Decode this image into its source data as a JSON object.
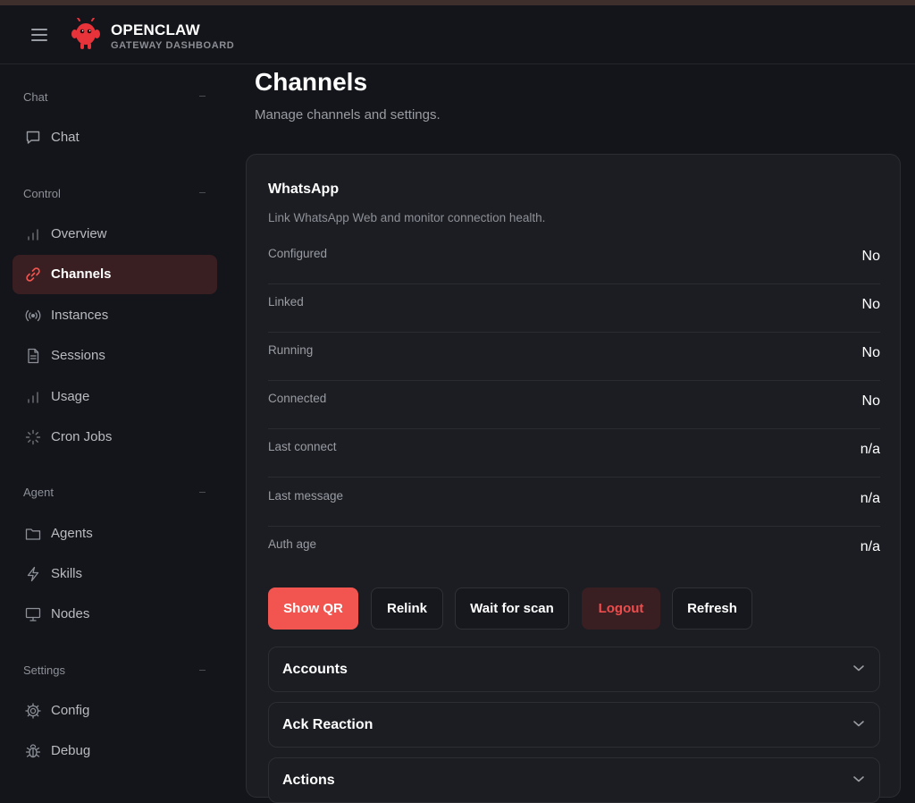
{
  "header": {
    "brand": "OPENCLAW",
    "subtitle": "GATEWAY DASHBOARD"
  },
  "sidebar": {
    "sections": [
      {
        "label": "Chat",
        "items": [
          {
            "label": "Chat",
            "icon": "chat-bubble-icon"
          }
        ]
      },
      {
        "label": "Control",
        "items": [
          {
            "label": "Overview",
            "icon": "bar-chart-icon"
          },
          {
            "label": "Channels",
            "icon": "link-icon",
            "active": true
          },
          {
            "label": "Instances",
            "icon": "radio-signal-icon"
          },
          {
            "label": "Sessions",
            "icon": "document-icon"
          },
          {
            "label": "Usage",
            "icon": "bar-chart-icon"
          },
          {
            "label": "Cron Jobs",
            "icon": "loader-icon"
          }
        ]
      },
      {
        "label": "Agent",
        "items": [
          {
            "label": "Agents",
            "icon": "folder-icon"
          },
          {
            "label": "Skills",
            "icon": "lightning-icon"
          },
          {
            "label": "Nodes",
            "icon": "monitor-icon"
          }
        ]
      },
      {
        "label": "Settings",
        "items": [
          {
            "label": "Config",
            "icon": "gear-icon"
          },
          {
            "label": "Debug",
            "icon": "bug-icon"
          }
        ]
      }
    ]
  },
  "main": {
    "title": "Channels",
    "subtitle": "Manage channels and settings.",
    "card": {
      "title": "WhatsApp",
      "description": "Link WhatsApp Web and monitor connection health.",
      "rows": [
        {
          "label": "Configured",
          "value": "No"
        },
        {
          "label": "Linked",
          "value": "No"
        },
        {
          "label": "Running",
          "value": "No"
        },
        {
          "label": "Connected",
          "value": "No"
        },
        {
          "label": "Last connect",
          "value": "n/a"
        },
        {
          "label": "Last message",
          "value": "n/a"
        },
        {
          "label": "Auth age",
          "value": "n/a"
        }
      ],
      "buttons": {
        "show_qr": "Show QR",
        "relink": "Relink",
        "wait_for_scan": "Wait for scan",
        "logout": "Logout",
        "refresh": "Refresh"
      },
      "accordions": [
        {
          "label": "Accounts"
        },
        {
          "label": "Ack Reaction"
        },
        {
          "label": "Actions"
        }
      ]
    }
  },
  "colors": {
    "accent": "#f2554f",
    "danger_text": "#ef4c4c",
    "active_bg": "#3a1f22",
    "background": "#13151a",
    "card_bg": "#1b1d23"
  }
}
